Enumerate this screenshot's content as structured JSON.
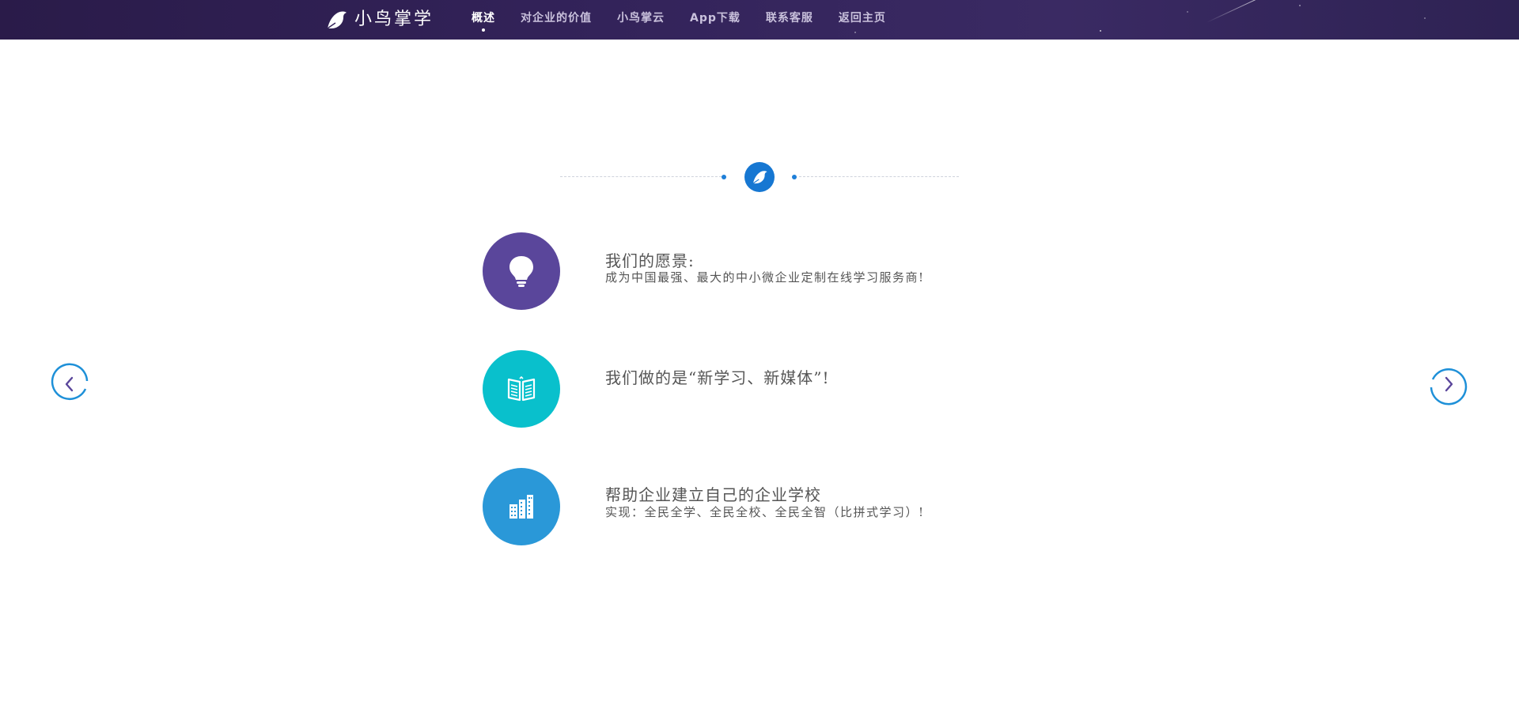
{
  "header": {
    "brand": "小鸟掌学",
    "nav": [
      {
        "label": "概述",
        "active": true
      },
      {
        "label": "对企业的价值",
        "active": false
      },
      {
        "label": "小鸟掌云",
        "active": false
      },
      {
        "label": "App下载",
        "active": false
      },
      {
        "label": "联系客服",
        "active": false
      },
      {
        "label": "返回主页",
        "active": false
      }
    ]
  },
  "main": {
    "divider_icon": "bird-icon",
    "features": [
      {
        "icon": "lightbulb-icon",
        "color": "#5a469b",
        "title": "我们的愿景:",
        "subtitle": "成为中国最强、最大的中小微企业定制在线学习服务商!"
      },
      {
        "icon": "book-icon",
        "color": "#09c0cc",
        "title": "我们做的是“新学习、新媒体”!",
        "subtitle": ""
      },
      {
        "icon": "buildings-icon",
        "color": "#2a98d8",
        "title": "帮助企业建立自己的企业学校",
        "subtitle": "实现：全民全学、全民全校、全民全智（比拼式学习）!"
      }
    ]
  },
  "carousel": {
    "prev_icon": "chevron-left-icon",
    "next_icon": "chevron-right-icon",
    "accent": "#1e90d8"
  },
  "colors": {
    "topbar": "#33235a",
    "accent": "#1677d2"
  }
}
